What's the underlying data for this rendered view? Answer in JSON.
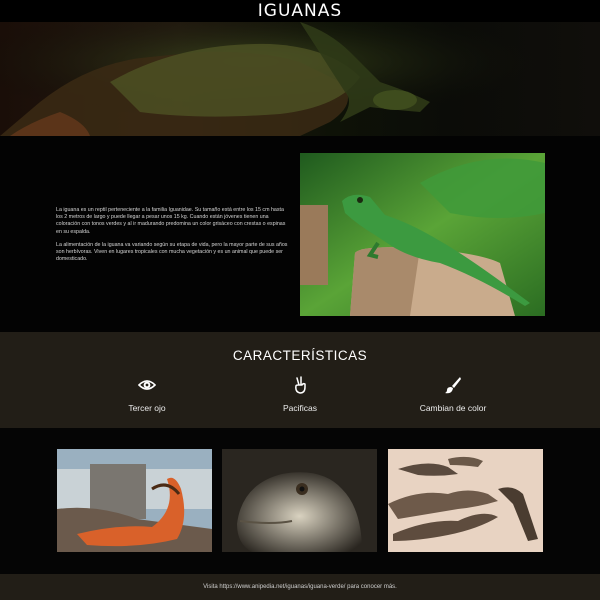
{
  "header": {
    "title": "IGUANAS"
  },
  "intro": {
    "paragraphs": [
      "La iguana es un reptil perteneciente a la familia Iguanidae. Su tamaño está entre los 15 cm hasta los 2 metros de largo y puede llegar a pesar unos 15 kg. Cuando están jóvenes tienen una coloración con tonos verdes y al ir madurando predomina un color grisáceo con crestas o espinas en su espalda.",
      "La alimentación de la iguana va variando según su etapa de vida, pero la mayor parte de sus años son herbívoras. Viven en lugares tropicales con mucha vegetación y es un animal que puede ser domesticado."
    ]
  },
  "features": {
    "title": "CARACTERÍSTICAS",
    "items": [
      {
        "label": "Tercer ojo",
        "icon": "eye-icon"
      },
      {
        "label": "Pacificas",
        "icon": "peace-hand-icon"
      },
      {
        "label": "Cambian de color",
        "icon": "paintbrush-icon"
      }
    ]
  },
  "footer": {
    "text": "Visita https://www.anipedia.net/iguanas/iguana-verde/ para conocer más."
  },
  "colors": {
    "background": "#050505",
    "section_dark": "#221e17",
    "accent_green": "#3f9a3a"
  }
}
